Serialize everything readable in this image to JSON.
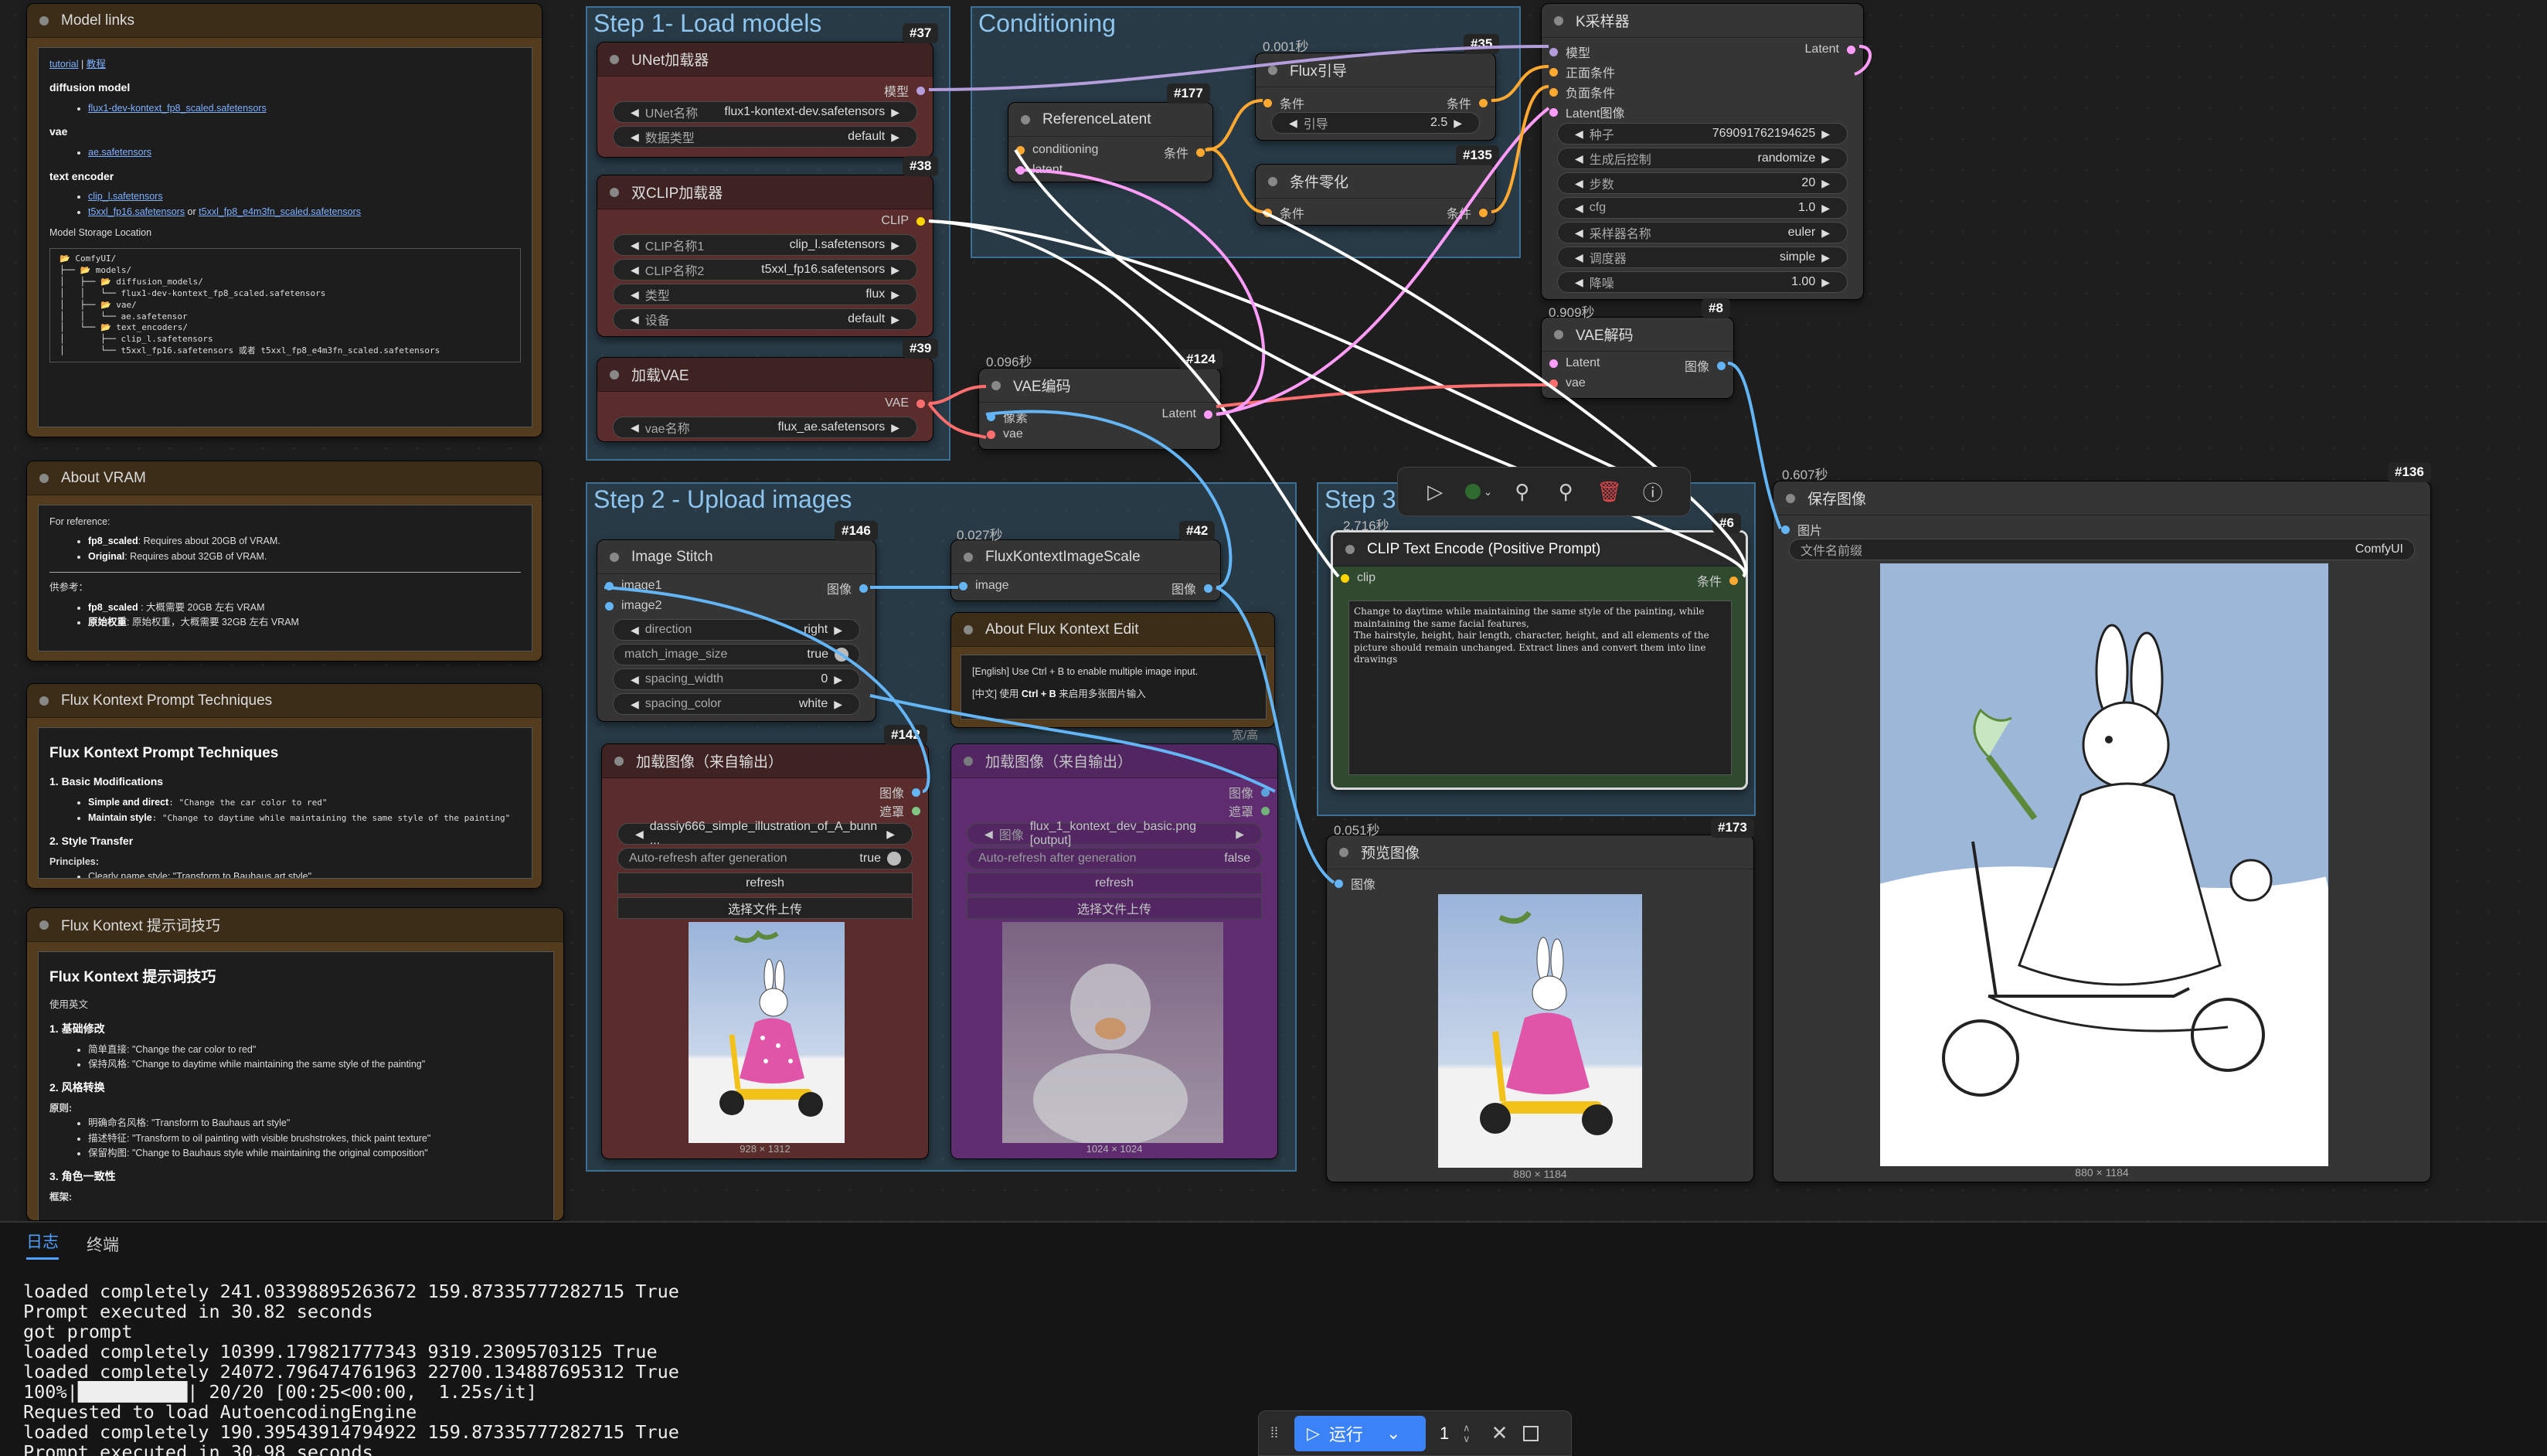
{
  "groups": {
    "step1": "Step 1- Load models",
    "cond": "Conditioning",
    "step2": "Step 2 - Upload images",
    "step3": "Step 3"
  },
  "model_links": {
    "title": "Model links",
    "tutorial": "tutorial",
    "sep": " | ",
    "tutorial_cn": "教程",
    "diffusion_h": "diffusion model",
    "diffusion_file": "flux1-dev-kontext_fp8_scaled.safetensors",
    "vae_h": "vae",
    "vae_file": "ae.safetensors",
    "te_h": "text encoder",
    "te_file1": "clip_l.safetensors",
    "te_file2": "t5xxl_fp16.safetensors",
    "te_or": " or ",
    "te_file3": "t5xxl_fp8_e4m3fn_scaled.safetensors",
    "storage_h": "Model Storage Location",
    "tree": "📂 ComfyUI/\n├── 📂 models/\n│   ├── 📂 diffusion_models/\n│   │   └── flux1-dev-kontext_fp8_scaled.safetensors\n│   ├── 📂 vae/\n│   │   └── ae.safetensor\n│   └── 📂 text_encoders/\n│       ├── clip_l.safetensors\n│       └── t5xxl_fp16.safetensors 或者 t5xxl_fp8_e4m3fn_scaled.safetensors"
  },
  "vram": {
    "title": "About VRAM",
    "ref": "For reference:",
    "l1b": "fp8_scaled",
    "l1": ": Requires about 20GB of VRAM.",
    "l2b": "Original",
    "l2": ": Requires about 32GB of VRAM.",
    "cn_h": "供参考：",
    "c1b": "fp8_scaled",
    "c1": " : 大概需要 20GB 左右 VRAM",
    "c2b": "原始权重",
    "c2": ": 原始权重，大概需要 32GB 左右 VRAM"
  },
  "tips_en": {
    "title": "Flux Kontext Prompt Techniques",
    "h": "Flux Kontext Prompt Techniques",
    "s1": "1. Basic Modifications",
    "s1a_b": "Simple and direct",
    "s1a": ": \"Change the car color to red\"",
    "s1b_b": "Maintain style",
    "s1b": ": \"Change to daytime while maintaining the same style of the painting\"",
    "s2": "2. Style Transfer",
    "p": "Principles:",
    "p1": "Clearly name style: \"Transform to Bauhaus art style\""
  },
  "tips_cn": {
    "title": "Flux Kontext 提示词技巧",
    "h": "Flux Kontext 提示词技巧",
    "use": "使用英文",
    "s1": "1. 基础修改",
    "a1": "简单直接: \"Change the car color to red\"",
    "a2": "保持风格: \"Change to daytime while maintaining the same style of the painting\"",
    "s2": "2. 风格转换",
    "p": "原则:",
    "b1": "明确命名风格: \"Transform to Bauhaus art style\"",
    "b2": "描述特征: \"Transform to oil painting with visible brushstrokes, thick paint texture\"",
    "b3": "保留构图: \"Change to Bauhaus style while maintaining the original composition\"",
    "s3": "3. 角色一致性",
    "p3": "框架:"
  },
  "unet": {
    "id": "#37",
    "title": "UNet加载器",
    "out": "模型",
    "w1l": "UNet名称",
    "w1v": "flux1-kontext-dev.safetensors",
    "w2l": "数据类型",
    "w2v": "default"
  },
  "clip": {
    "id": "#38",
    "title": "双CLIP加载器",
    "out": "CLIP",
    "w1l": "CLIP名称1",
    "w1v": "clip_l.safetensors",
    "w2l": "CLIP名称2",
    "w2v": "t5xxl_fp16.safetensors",
    "w3l": "类型",
    "w3v": "flux",
    "w4l": "设备",
    "w4v": "default"
  },
  "vaeload": {
    "id": "#39",
    "title": "加载VAE",
    "out": "VAE",
    "w1l": "vae名称",
    "w1v": "flux_ae.safetensors"
  },
  "reflatent": {
    "id": "#177",
    "title": "ReferenceLatent",
    "in1": "conditioning",
    "in2": "latent",
    "out": "条件"
  },
  "fluxguide": {
    "id": "#35",
    "time": "0.001秒",
    "title": "Flux引导",
    "in": "条件",
    "out": "条件",
    "w1l": "引导",
    "w1v": "2.5"
  },
  "zero": {
    "id": "#135",
    "title": "条件零化",
    "in": "条件",
    "out": "条件"
  },
  "ksampler": {
    "title": "K采样器",
    "in1": "模型",
    "in2": "正面条件",
    "in3": "负面条件",
    "in4": "Latent图像",
    "out": "Latent",
    "w": [
      {
        "l": "种子",
        "v": "769091762194625"
      },
      {
        "l": "生成后控制",
        "v": "randomize"
      },
      {
        "l": "步数",
        "v": "20"
      },
      {
        "l": "cfg",
        "v": "1.0"
      },
      {
        "l": "采样器名称",
        "v": "euler"
      },
      {
        "l": "调度器",
        "v": "simple"
      },
      {
        "l": "降噪",
        "v": "1.00"
      }
    ]
  },
  "vaeenc": {
    "id": "#124",
    "time": "0.096秒",
    "title": "VAE编码",
    "in1": "像素",
    "in2": "vae",
    "out": "Latent"
  },
  "vaedec": {
    "id": "#8",
    "time": "0.909秒",
    "title": "VAE解码",
    "in1": "Latent",
    "in2": "vae",
    "out": "图像"
  },
  "stitch": {
    "id": "#146",
    "title": "Image Stitch",
    "in1": "image1",
    "in2": "image2",
    "out": "图像",
    "w": [
      {
        "l": "direction",
        "v": "right"
      },
      {
        "l": "match_image_size",
        "v": "true"
      },
      {
        "l": "spacing_width",
        "v": "0"
      },
      {
        "l": "spacing_color",
        "v": "white"
      }
    ]
  },
  "scale": {
    "id": "#42",
    "time": "0.027秒",
    "title": "FluxKontextImageScale",
    "in": "image",
    "out": "图像"
  },
  "about": {
    "title": "About Flux Kontext Edit",
    "en": "[English] Use Ctrl + B to enable multiple image input.",
    "cn1": "[中文] 使用 ",
    "cn_b": "Ctrl + B",
    "cn2": " 来启用多张图片输入"
  },
  "load1": {
    "id": "#142",
    "title": "加载图像（来自输出）",
    "out1": "图像",
    "out2": "遮罩",
    "file": "dassiy666_simple_illustration_of_A_bunn ...",
    "auto_l": "Auto-refresh after generation",
    "auto_v": "true",
    "refresh": "refresh",
    "upload": "选择文件上传",
    "dim": "928 × 1312"
  },
  "load2": {
    "title": "加载图像（来自输出）",
    "out1": "图像",
    "out2": "遮罩",
    "file": "flux_1_kontext_dev_basic.png [output]",
    "file_l": "图像",
    "auto_l": "Auto-refresh after generation",
    "auto_v": "false",
    "refresh": "refresh",
    "upload": "选择文件上传",
    "dim": "1024 × 1024",
    "tag": "宽/高"
  },
  "clipenc": {
    "id": "#6",
    "time": "2.716秒",
    "title": "CLIP Text Encode (Positive Prompt)",
    "in": "clip",
    "out": "条件",
    "text": "Change to daytime while maintaining the same style of the painting, while maintaining the same facial features,\nThe hairstyle, height, hair length, character, height, and all elements of the picture should remain unchanged. Extract lines and convert them into line drawings"
  },
  "preview": {
    "id": "#173",
    "time": "0.051秒",
    "title": "预览图像",
    "in": "图像",
    "dim": "880 × 1184"
  },
  "save": {
    "id": "#136",
    "time": "0.607秒",
    "title": "保存图像",
    "in": "图片",
    "w1l": "文件名前缀",
    "w1v": "ComfyUI",
    "dim": "880 × 1184"
  },
  "bottom": {
    "tab1": "日志",
    "tab2": "终端",
    "logs": "loaded completely 241.03398895263672 159.87335777282715 True\nPrompt executed in 30.82 seconds\ngot prompt\nloaded completely 10399.179821777343 9319.23095703125 True\nloaded completely 24072.796474761963 22700.134887695312 True\n100%|██████████| 20/20 [00:25<00:00,  1.25s/it]\nRequested to load AutoencodingEngine\nloaded completely 190.39543914794922 159.87335777282715 True\nPrompt executed in 30.98 seconds"
  },
  "run": {
    "label": "运行",
    "count": "1"
  },
  "colors": {
    "model": "#b39ddb",
    "clip": "#ffd500",
    "vae": "#ff6e6e",
    "latent": "#ff9cf9",
    "image": "#64b5f6",
    "cond": "#ffa931"
  }
}
